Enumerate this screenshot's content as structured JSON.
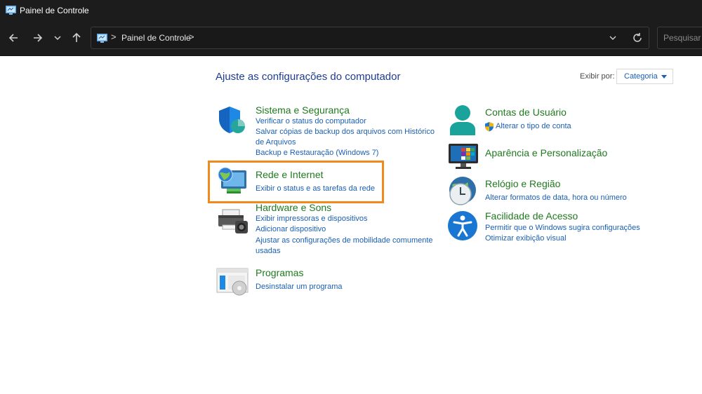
{
  "window": {
    "title": "Painel de Controle"
  },
  "toolbar": {
    "back_icon": "arrow-left-icon",
    "forward_icon": "arrow-right-icon",
    "recent_icon": "chevron-down-icon",
    "up_icon": "arrow-up-icon",
    "address": {
      "crumb": "Painel de Controle",
      "separator": ">"
    },
    "search": {
      "placeholder": "Pesquisar P"
    }
  },
  "main": {
    "heading": "Ajuste as configurações do computador",
    "view_by": {
      "label": "Exibir por:",
      "value": "Categoria"
    },
    "categories": [
      {
        "title": "Sistema e Segurança",
        "icon": "shield-icon",
        "links": [
          "Verificar o status do computador",
          "Salvar cópias de backup dos arquivos com Histórico de Arquivos",
          "Backup e Restauração (Windows 7)"
        ]
      },
      {
        "title": "Rede e Internet",
        "icon": "network-globe-icon",
        "links": [
          "Exibir o status e as tarefas da rede"
        ]
      },
      {
        "title": "Hardware e Sons",
        "icon": "printer-icon",
        "links": [
          "Exibir impressoras e dispositivos",
          "Adicionar dispositivo",
          "Ajustar as configurações de mobilidade comumente usadas"
        ]
      },
      {
        "title": "Programas",
        "icon": "programs-icon",
        "links": [
          "Desinstalar um programa"
        ]
      },
      {
        "title": "Contas de Usuário",
        "icon": "user-icon",
        "links": [
          "Alterar o tipo de conta"
        ]
      },
      {
        "title": "Aparência e Personalização",
        "icon": "monitor-icon",
        "links": []
      },
      {
        "title": "Relógio e Região",
        "icon": "clock-globe-icon",
        "links": [
          "Alterar formatos de data, hora ou número"
        ]
      },
      {
        "title": "Facilidade de Acesso",
        "icon": "accessibility-icon",
        "links": [
          "Permitir que o Windows sugira configurações",
          "Otimizar exibição visual"
        ]
      }
    ]
  },
  "colors": {
    "titlebar": "#1c1c1c",
    "category_title": "#1f7a1f",
    "link": "#1a5fb4",
    "heading": "#1f3d8f",
    "highlight": "#f08a1c"
  }
}
